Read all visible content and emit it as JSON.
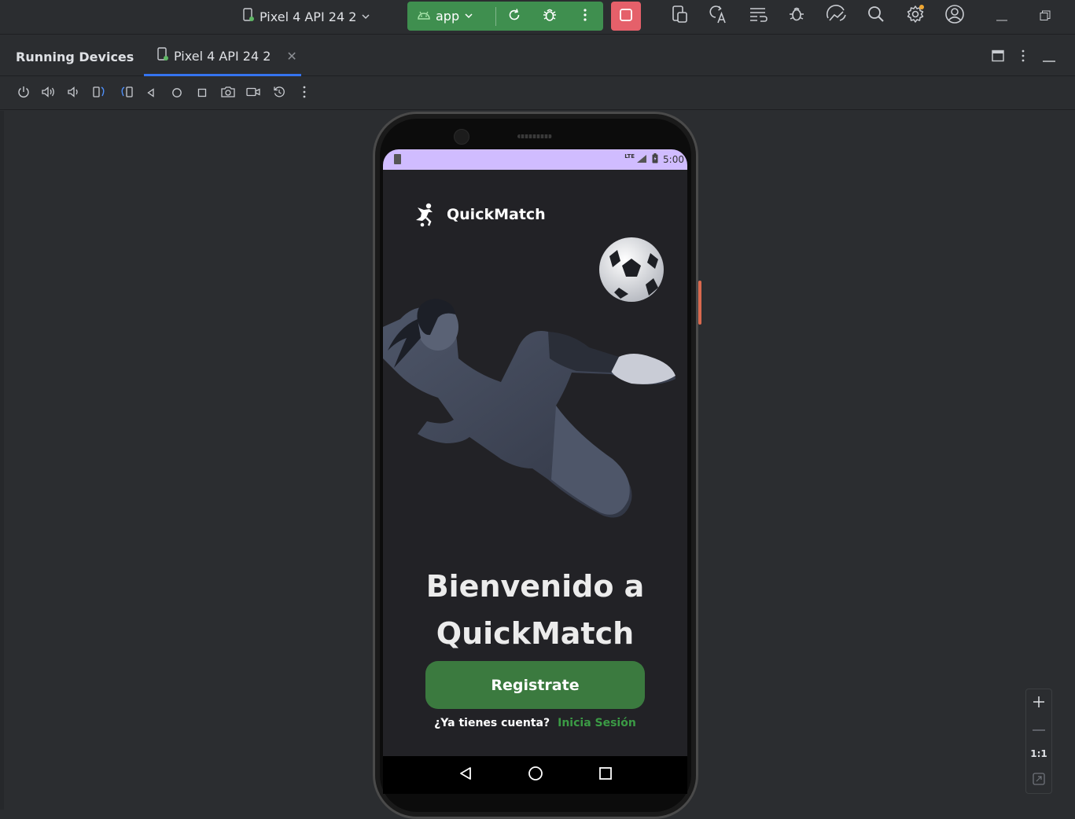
{
  "toolbar": {
    "device_name": "Pixel 4 API 24 2",
    "run_config": "app",
    "accent_run": "#3f8f4f",
    "accent_stop": "#e5606a"
  },
  "panel": {
    "title": "Running Devices",
    "tab_label": "Pixel 4 API 24 2"
  },
  "device_toolbar": {
    "icons": [
      "power-icon",
      "volume-up-icon",
      "volume-down-icon",
      "rotate-left-icon",
      "rotate-right-icon",
      "back-icon",
      "home-icon",
      "overview-icon",
      "screenshot-icon",
      "screen-record-icon",
      "reset-icon",
      "more-icon"
    ]
  },
  "phone": {
    "status_time": "5:00",
    "status_network": "LTE",
    "app_name": "QuickMatch",
    "welcome_line1": "Bienvenido a",
    "welcome_line2": "QuickMatch",
    "register_label": "Registrate",
    "login_question": "¿Ya tienes cuenta?",
    "login_link": "Inicia Sesión",
    "status_bar_color": "#d0bcff",
    "button_color": "#3b7a3f",
    "link_color": "#3b9b45"
  },
  "zoom": {
    "actual_size": "1:1"
  }
}
